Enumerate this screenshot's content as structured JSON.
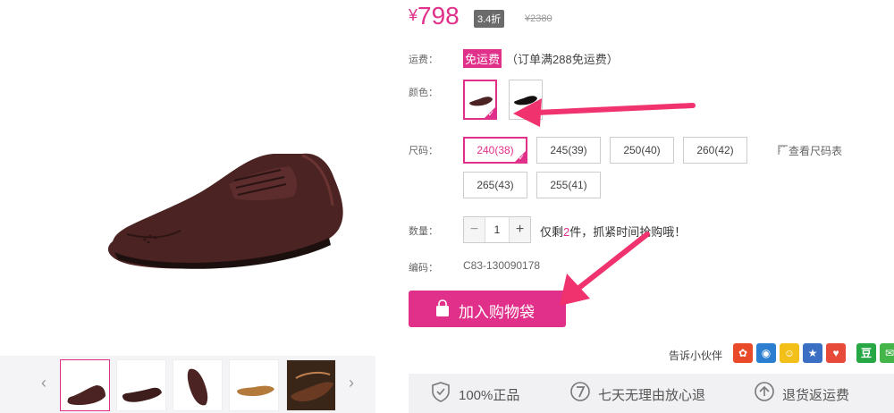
{
  "product": {
    "price_symbol": "¥",
    "price": "798",
    "discount": "3.4折",
    "original_price": "¥2380"
  },
  "shipping": {
    "label": "运费：",
    "badge": "免运费",
    "note": "（订单满288免运费）"
  },
  "color": {
    "label": "颜色："
  },
  "size": {
    "label": "尺码：",
    "options": [
      "240(38)",
      "245(39)",
      "250(40)",
      "260(42)",
      "265(43)",
      "255(41)"
    ],
    "selected_index": 0,
    "chart_link": "查看尺码表"
  },
  "quantity": {
    "label": "数量：",
    "minus": "−",
    "value": "1",
    "plus": "+",
    "stock_prefix": "仅剩",
    "stock_count": "2",
    "stock_suffix": "件，抓紧时间抢购哦！"
  },
  "code": {
    "label": "编码：",
    "value": "C83-130090178"
  },
  "cart": {
    "add_label": "加入购物袋"
  },
  "share": {
    "label": "告诉小伙伴",
    "icons": [
      "weibo-icon",
      "renren-icon",
      "kaixin-icon",
      "qzone-icon",
      "douban-icon",
      "wechat-icon"
    ],
    "douban_text": "豆"
  },
  "guarantees": [
    {
      "icon": "shield-icon",
      "label": "100%正品"
    },
    {
      "icon": "seven-days-icon",
      "label": "七天无理由放心退"
    },
    {
      "icon": "return-icon",
      "label": "退货返运费"
    }
  ],
  "colors": {
    "accent": "#e0308a",
    "shoe_brown": "#4a2322",
    "annotation_arrow": "#f0326e"
  }
}
